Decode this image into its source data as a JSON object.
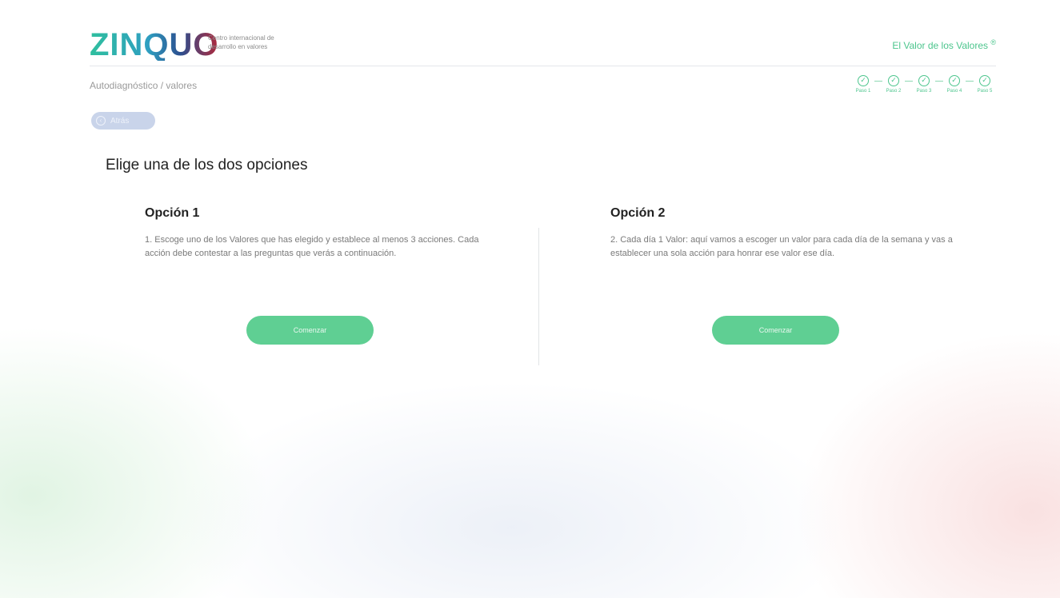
{
  "header": {
    "logo_text": "ZINQUO",
    "logo_tagline": "Centro internacional de desarrollo en valores",
    "brand_title": "El Valor de los Valores",
    "brand_mark": "®"
  },
  "breadcrumb": "Autodiagnóstico / valores",
  "steps": [
    {
      "label": "Paso 1",
      "icon": "check-circle-icon"
    },
    {
      "label": "Paso 2",
      "icon": "check-circle-icon"
    },
    {
      "label": "Paso 3",
      "icon": "check-circle-icon"
    },
    {
      "label": "Paso 4",
      "icon": "check-circle-icon"
    },
    {
      "label": "Paso 5",
      "icon": "check-circle-icon"
    }
  ],
  "back_button": {
    "label": "Atrás",
    "icon": "arrow-left-icon"
  },
  "page_title": "Elige una de los dos opciones",
  "options": [
    {
      "title": "Opción 1",
      "description": "1. Escoge uno de los Valores que has elegido y establece al menos 3 acciones. Cada acción debe contestar a las preguntas que verás a continuación.",
      "button_label": "Comenzar"
    },
    {
      "title": "Opción 2",
      "description": "2. Cada día 1 Valor: aquí vamos a escoger un valor para cada día de la semana y vas a establecer una sola acción para honrar ese valor ese día.",
      "button_label": "Comenzar"
    }
  ],
  "colors": {
    "accent_green": "#5fcf93",
    "brand_green": "#4cc58d",
    "back_button": "#c9d4ea"
  }
}
